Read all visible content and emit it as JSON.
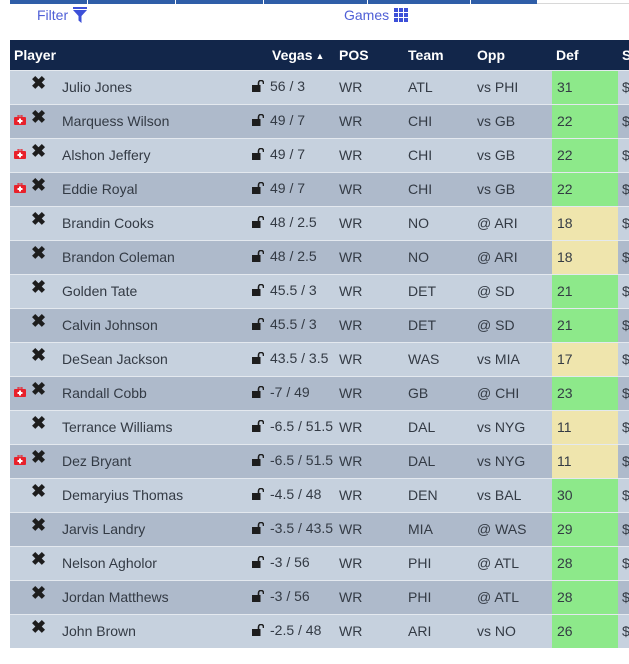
{
  "toolbar": {
    "filter_label": "Filter",
    "filter_icon": "funnel-icon",
    "games_label": "Games",
    "games_icon": "grid-icon"
  },
  "colors": {
    "header_bg": "#12264a",
    "row_light": "#c6d1de",
    "row_dark": "#aebacb",
    "def_good": "#8de98a",
    "def_neutral": "#efe5ad",
    "injury": "#e8202a",
    "link": "#4f5fd6",
    "nav": "#2f5ea8"
  },
  "table": {
    "headers": {
      "player": "Player",
      "vegas": "Vegas",
      "vegas_sort": "▲",
      "pos": "POS",
      "team": "Team",
      "opp": "Opp",
      "def": "Def",
      "sal": "S"
    },
    "rows": [
      {
        "injured": false,
        "name": "Julio Jones",
        "vegas": "56 / 3",
        "pos": "WR",
        "team": "ATL",
        "opp": "vs PHI",
        "def": "31",
        "def_level": "green",
        "sal": "$"
      },
      {
        "injured": true,
        "name": "Marquess Wilson",
        "vegas": "49 / 7",
        "pos": "WR",
        "team": "CHI",
        "opp": "vs GB",
        "def": "22",
        "def_level": "green",
        "sal": "$"
      },
      {
        "injured": true,
        "name": "Alshon Jeffery",
        "vegas": "49 / 7",
        "pos": "WR",
        "team": "CHI",
        "opp": "vs GB",
        "def": "22",
        "def_level": "green",
        "sal": "$"
      },
      {
        "injured": true,
        "name": "Eddie Royal",
        "vegas": "49 / 7",
        "pos": "WR",
        "team": "CHI",
        "opp": "vs GB",
        "def": "22",
        "def_level": "green",
        "sal": "$"
      },
      {
        "injured": false,
        "name": "Brandin Cooks",
        "vegas": "48 / 2.5",
        "pos": "WR",
        "team": "NO",
        "opp": "@ ARI",
        "def": "18",
        "def_level": "yellow",
        "sal": "$"
      },
      {
        "injured": false,
        "name": "Brandon Coleman",
        "vegas": "48 / 2.5",
        "pos": "WR",
        "team": "NO",
        "opp": "@ ARI",
        "def": "18",
        "def_level": "yellow",
        "sal": "$"
      },
      {
        "injured": false,
        "name": "Golden Tate",
        "vegas": "45.5 / 3",
        "pos": "WR",
        "team": "DET",
        "opp": "@ SD",
        "def": "21",
        "def_level": "green",
        "sal": "$"
      },
      {
        "injured": false,
        "name": "Calvin Johnson",
        "vegas": "45.5 / 3",
        "pos": "WR",
        "team": "DET",
        "opp": "@ SD",
        "def": "21",
        "def_level": "green",
        "sal": "$"
      },
      {
        "injured": false,
        "name": "DeSean Jackson",
        "vegas": "43.5 / 3.5",
        "pos": "WR",
        "team": "WAS",
        "opp": "vs MIA",
        "def": "17",
        "def_level": "yellow",
        "sal": "$"
      },
      {
        "injured": true,
        "name": "Randall Cobb",
        "vegas": "-7 / 49",
        "pos": "WR",
        "team": "GB",
        "opp": "@ CHI",
        "def": "23",
        "def_level": "green",
        "sal": "$"
      },
      {
        "injured": false,
        "name": "Terrance Williams",
        "vegas": "-6.5 / 51.5",
        "pos": "WR",
        "team": "DAL",
        "opp": "vs NYG",
        "def": "11",
        "def_level": "yellow",
        "sal": "$"
      },
      {
        "injured": true,
        "name": "Dez Bryant",
        "vegas": "-6.5 / 51.5",
        "pos": "WR",
        "team": "DAL",
        "opp": "vs NYG",
        "def": "11",
        "def_level": "yellow",
        "sal": "$"
      },
      {
        "injured": false,
        "name": "Demaryius Thomas",
        "vegas": "-4.5 / 48",
        "pos": "WR",
        "team": "DEN",
        "opp": "vs BAL",
        "def": "30",
        "def_level": "green",
        "sal": "$"
      },
      {
        "injured": false,
        "name": "Jarvis Landry",
        "vegas": "-3.5 / 43.5",
        "pos": "WR",
        "team": "MIA",
        "opp": "@ WAS",
        "def": "29",
        "def_level": "green",
        "sal": "$"
      },
      {
        "injured": false,
        "name": "Nelson Agholor",
        "vegas": "-3 / 56",
        "pos": "WR",
        "team": "PHI",
        "opp": "@ ATL",
        "def": "28",
        "def_level": "green",
        "sal": "$"
      },
      {
        "injured": false,
        "name": "Jordan Matthews",
        "vegas": "-3 / 56",
        "pos": "WR",
        "team": "PHI",
        "opp": "@ ATL",
        "def": "28",
        "def_level": "green",
        "sal": "$"
      },
      {
        "injured": false,
        "name": "John Brown",
        "vegas": "-2.5 / 48",
        "pos": "WR",
        "team": "ARI",
        "opp": "vs NO",
        "def": "26",
        "def_level": "green",
        "sal": "$"
      }
    ]
  }
}
